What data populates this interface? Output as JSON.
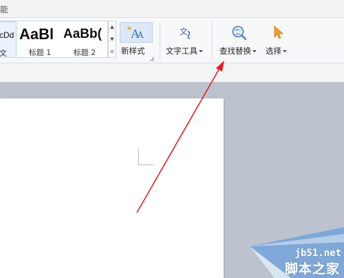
{
  "titlebar": {
    "fragment": "能"
  },
  "styles": [
    {
      "sample": "cDd",
      "label": "文"
    },
    {
      "sample": "AaBl",
      "label": "标题 1"
    },
    {
      "sample": "AaBb(",
      "label": "标题 2"
    }
  ],
  "ribbon": {
    "new_style": "新样式",
    "text_tools": "文字工具",
    "find_replace": "查找替换",
    "select": "选择"
  },
  "watermark": {
    "url": "jb51.net",
    "name": "脚本之家"
  },
  "annotation": {
    "color": "#e02020"
  }
}
